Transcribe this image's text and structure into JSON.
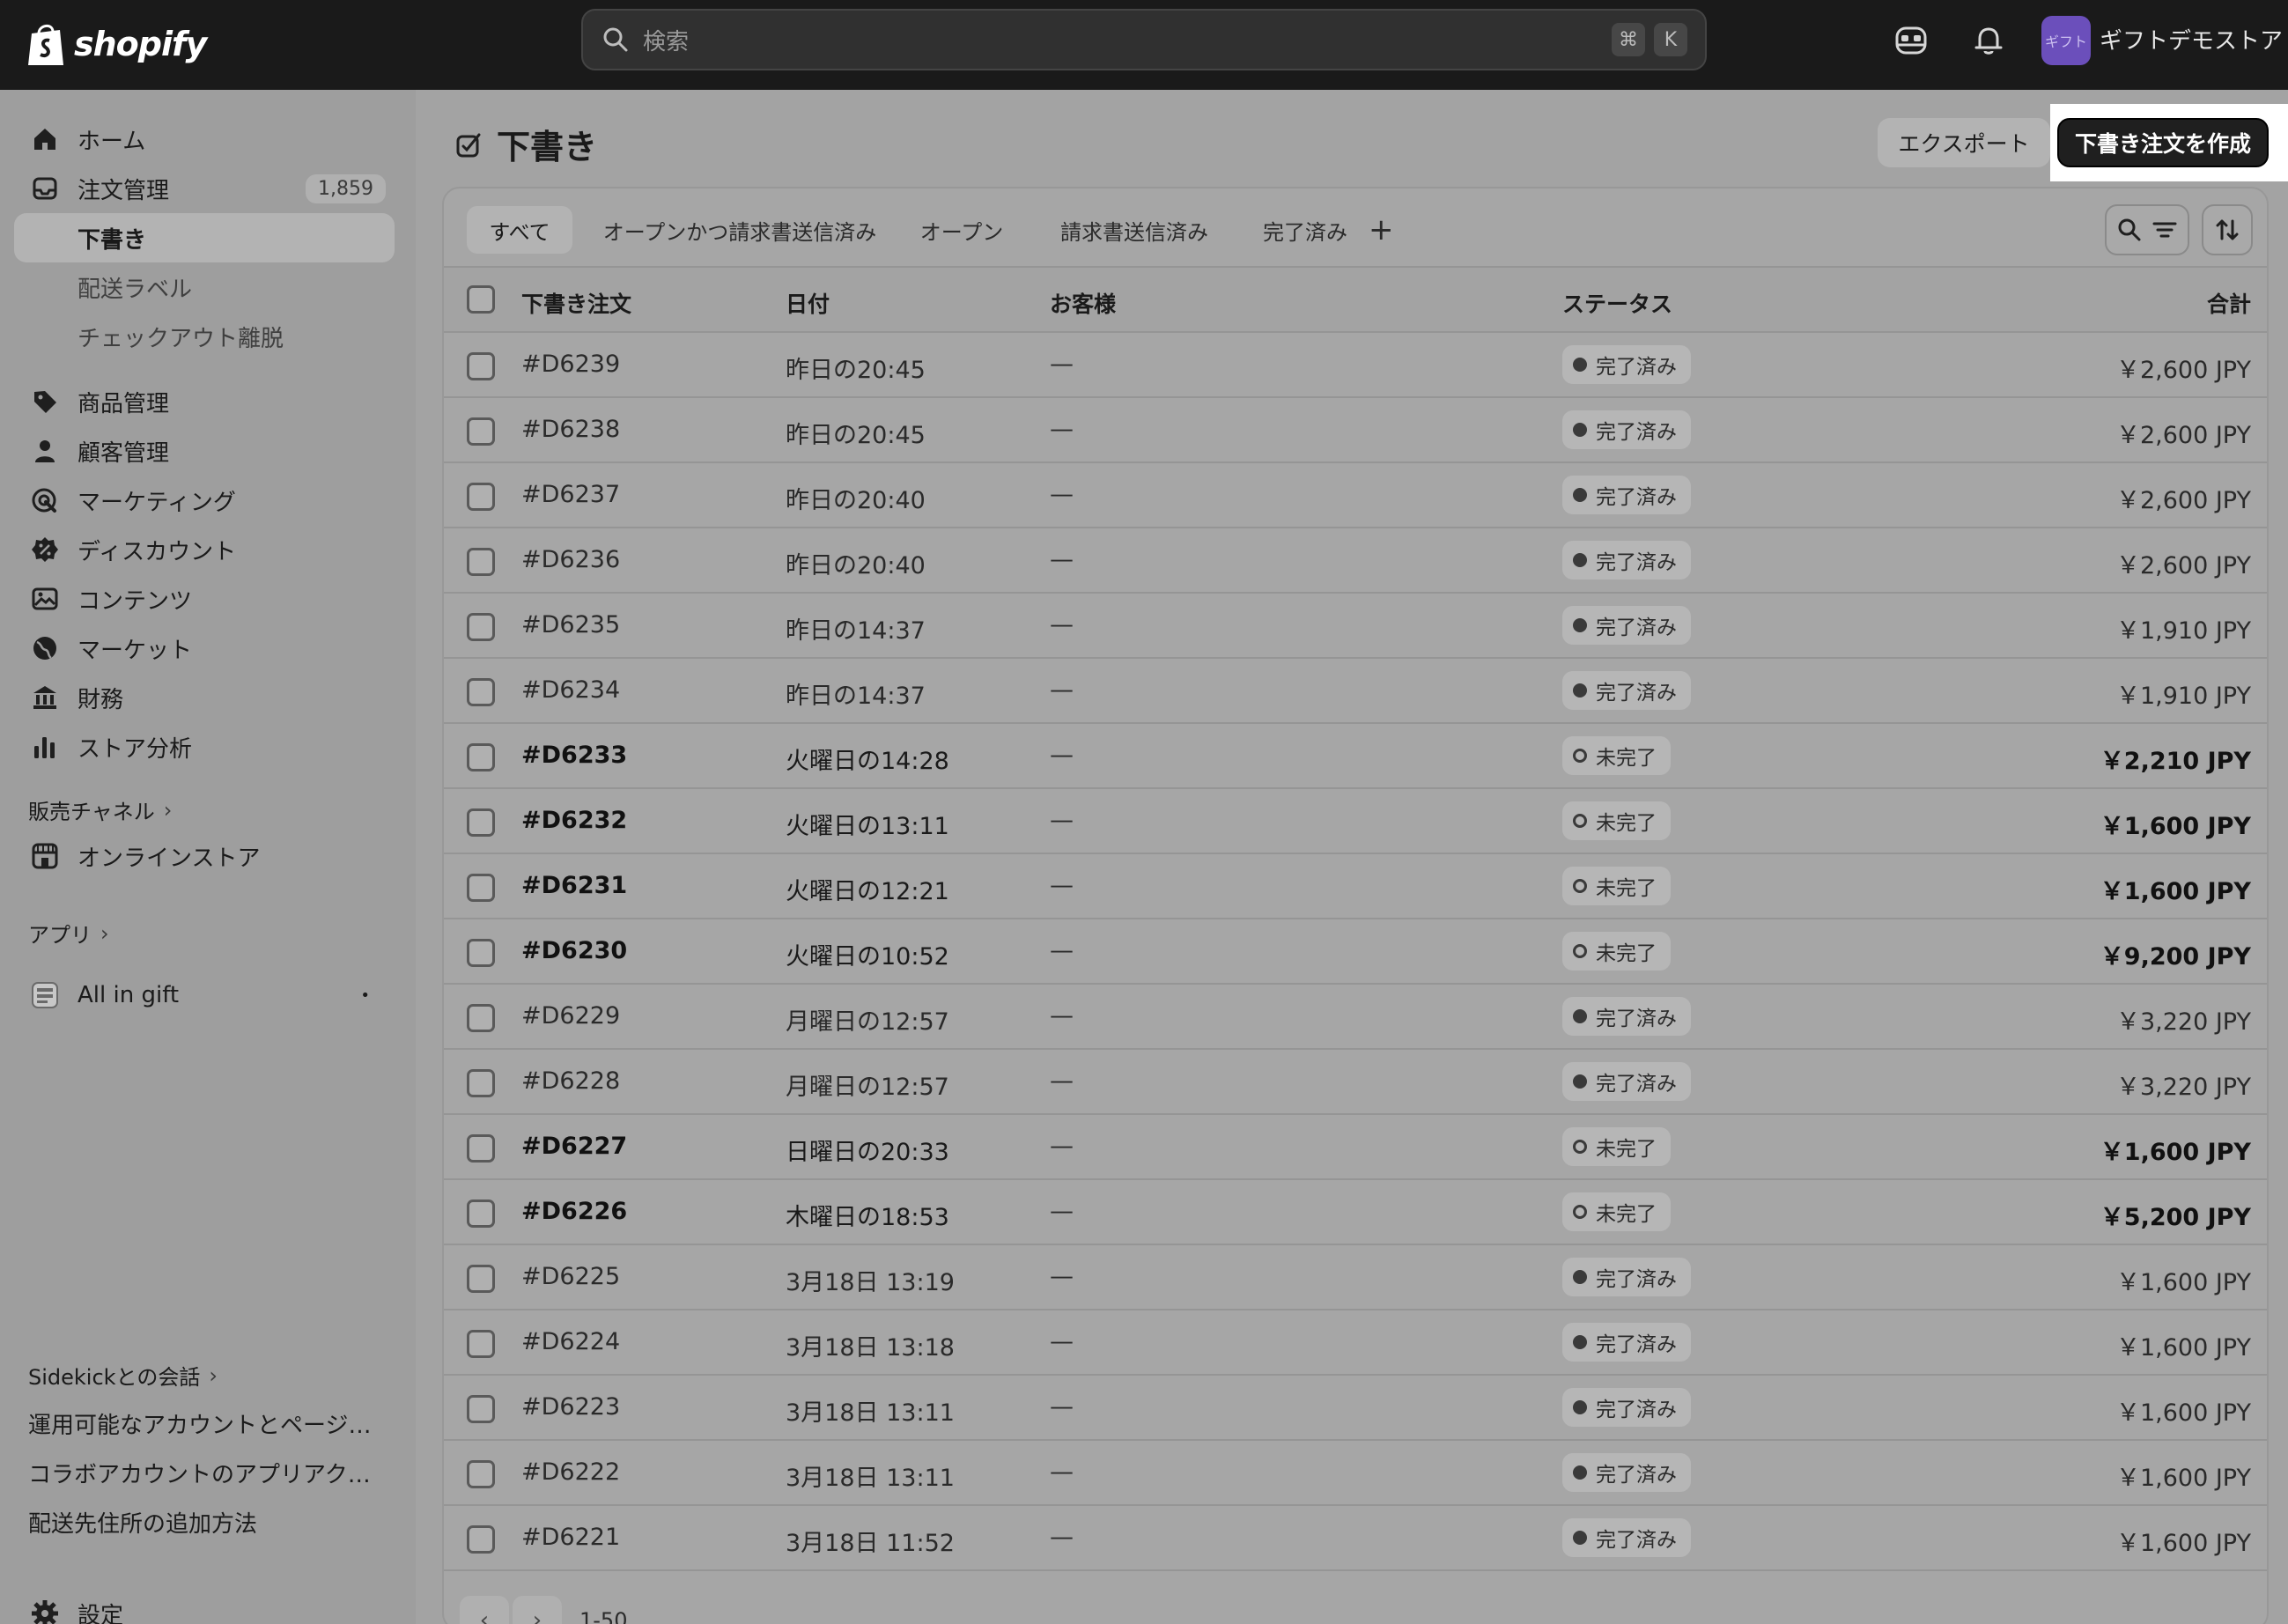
{
  "topbar": {
    "logo_text": "shopify",
    "search_placeholder": "検索",
    "shortcut_cmd": "⌘",
    "shortcut_key": "K",
    "store_avatar_text": "ギフト",
    "store_name": "ギフトデモストア"
  },
  "sidebar": {
    "items": [
      {
        "label": "ホーム",
        "icon": "home-icon"
      },
      {
        "label": "注文管理",
        "icon": "inbox-icon",
        "badge": "1,859"
      },
      {
        "label": "下書き",
        "active": true
      },
      {
        "label": "配送ラベル"
      },
      {
        "label": "チェックアウト離脱"
      },
      {
        "label": "商品管理",
        "icon": "tag-icon"
      },
      {
        "label": "顧客管理",
        "icon": "person-icon"
      },
      {
        "label": "マーケティング",
        "icon": "target-icon"
      },
      {
        "label": "ディスカウント",
        "icon": "discount-icon"
      },
      {
        "label": "コンテンツ",
        "icon": "image-icon"
      },
      {
        "label": "マーケット",
        "icon": "globe-icon"
      },
      {
        "label": "財務",
        "icon": "bank-icon"
      },
      {
        "label": "ストア分析",
        "icon": "bar-chart-icon"
      }
    ],
    "sales_channels_label": "販売チャネル",
    "online_store_label": "オンラインストア",
    "apps_label": "アプリ",
    "app_item_label": "All in gift",
    "app_item_dot": "•",
    "sidekick_label": "Sidekickとの会話",
    "help_links": [
      "運用可能なアカウントとページを確認する方法",
      "コラボアカウントのアプリアクセス権限について",
      "配送先住所の追加方法"
    ],
    "settings_label": "設定"
  },
  "header": {
    "title": "下書き",
    "export_label": "エクスポート",
    "create_label": "下書き注文を作成"
  },
  "tabs": [
    {
      "label": "すべて",
      "active": true
    },
    {
      "label": "オープンかつ請求書送信済み"
    },
    {
      "label": "オープン"
    },
    {
      "label": "請求書送信済み"
    },
    {
      "label": "完了済み"
    }
  ],
  "tab_add_label": "+",
  "table": {
    "columns": [
      "下書き注文",
      "日付",
      "お客様",
      "ステータス",
      "合計"
    ],
    "rows": [
      {
        "id": "#D6239",
        "date": "昨日の20:45",
        "customer": "—",
        "status": "完了済み",
        "done": true,
        "total": "￥2,600 JPY"
      },
      {
        "id": "#D6238",
        "date": "昨日の20:45",
        "customer": "—",
        "status": "完了済み",
        "done": true,
        "total": "￥2,600 JPY"
      },
      {
        "id": "#D6237",
        "date": "昨日の20:40",
        "customer": "—",
        "status": "完了済み",
        "done": true,
        "total": "￥2,600 JPY"
      },
      {
        "id": "#D6236",
        "date": "昨日の20:40",
        "customer": "—",
        "status": "完了済み",
        "done": true,
        "total": "￥2,600 JPY"
      },
      {
        "id": "#D6235",
        "date": "昨日の14:37",
        "customer": "—",
        "status": "完了済み",
        "done": true,
        "total": "￥1,910 JPY"
      },
      {
        "id": "#D6234",
        "date": "昨日の14:37",
        "customer": "—",
        "status": "完了済み",
        "done": true,
        "total": "￥1,910 JPY"
      },
      {
        "id": "#D6233",
        "date": "火曜日の14:28",
        "customer": "—",
        "status": "未完了",
        "done": false,
        "total": "￥2,210 JPY"
      },
      {
        "id": "#D6232",
        "date": "火曜日の13:11",
        "customer": "—",
        "status": "未完了",
        "done": false,
        "total": "￥1,600 JPY"
      },
      {
        "id": "#D6231",
        "date": "火曜日の12:21",
        "customer": "—",
        "status": "未完了",
        "done": false,
        "total": "￥1,600 JPY"
      },
      {
        "id": "#D6230",
        "date": "火曜日の10:52",
        "customer": "—",
        "status": "未完了",
        "done": false,
        "total": "￥9,200 JPY"
      },
      {
        "id": "#D6229",
        "date": "月曜日の12:57",
        "customer": "—",
        "status": "完了済み",
        "done": true,
        "total": "￥3,220 JPY"
      },
      {
        "id": "#D6228",
        "date": "月曜日の12:57",
        "customer": "—",
        "status": "完了済み",
        "done": true,
        "total": "￥3,220 JPY"
      },
      {
        "id": "#D6227",
        "date": "日曜日の20:33",
        "customer": "—",
        "status": "未完了",
        "done": false,
        "total": "￥1,600 JPY"
      },
      {
        "id": "#D6226",
        "date": "木曜日の18:53",
        "customer": "—",
        "status": "未完了",
        "done": false,
        "total": "￥5,200 JPY"
      },
      {
        "id": "#D6225",
        "date": "3月18日 13:19",
        "customer": "—",
        "status": "完了済み",
        "done": true,
        "total": "￥1,600 JPY"
      },
      {
        "id": "#D6224",
        "date": "3月18日 13:18",
        "customer": "—",
        "status": "完了済み",
        "done": true,
        "total": "￥1,600 JPY"
      },
      {
        "id": "#D6223",
        "date": "3月18日 13:11",
        "customer": "—",
        "status": "完了済み",
        "done": true,
        "total": "￥1,600 JPY"
      },
      {
        "id": "#D6222",
        "date": "3月18日 13:11",
        "customer": "—",
        "status": "完了済み",
        "done": true,
        "total": "￥1,600 JPY"
      },
      {
        "id": "#D6221",
        "date": "3月18日 11:52",
        "customer": "—",
        "status": "完了済み",
        "done": true,
        "total": "￥1,600 JPY"
      }
    ]
  },
  "pagination": {
    "prev": "‹",
    "next": "›",
    "range": "1-50"
  }
}
